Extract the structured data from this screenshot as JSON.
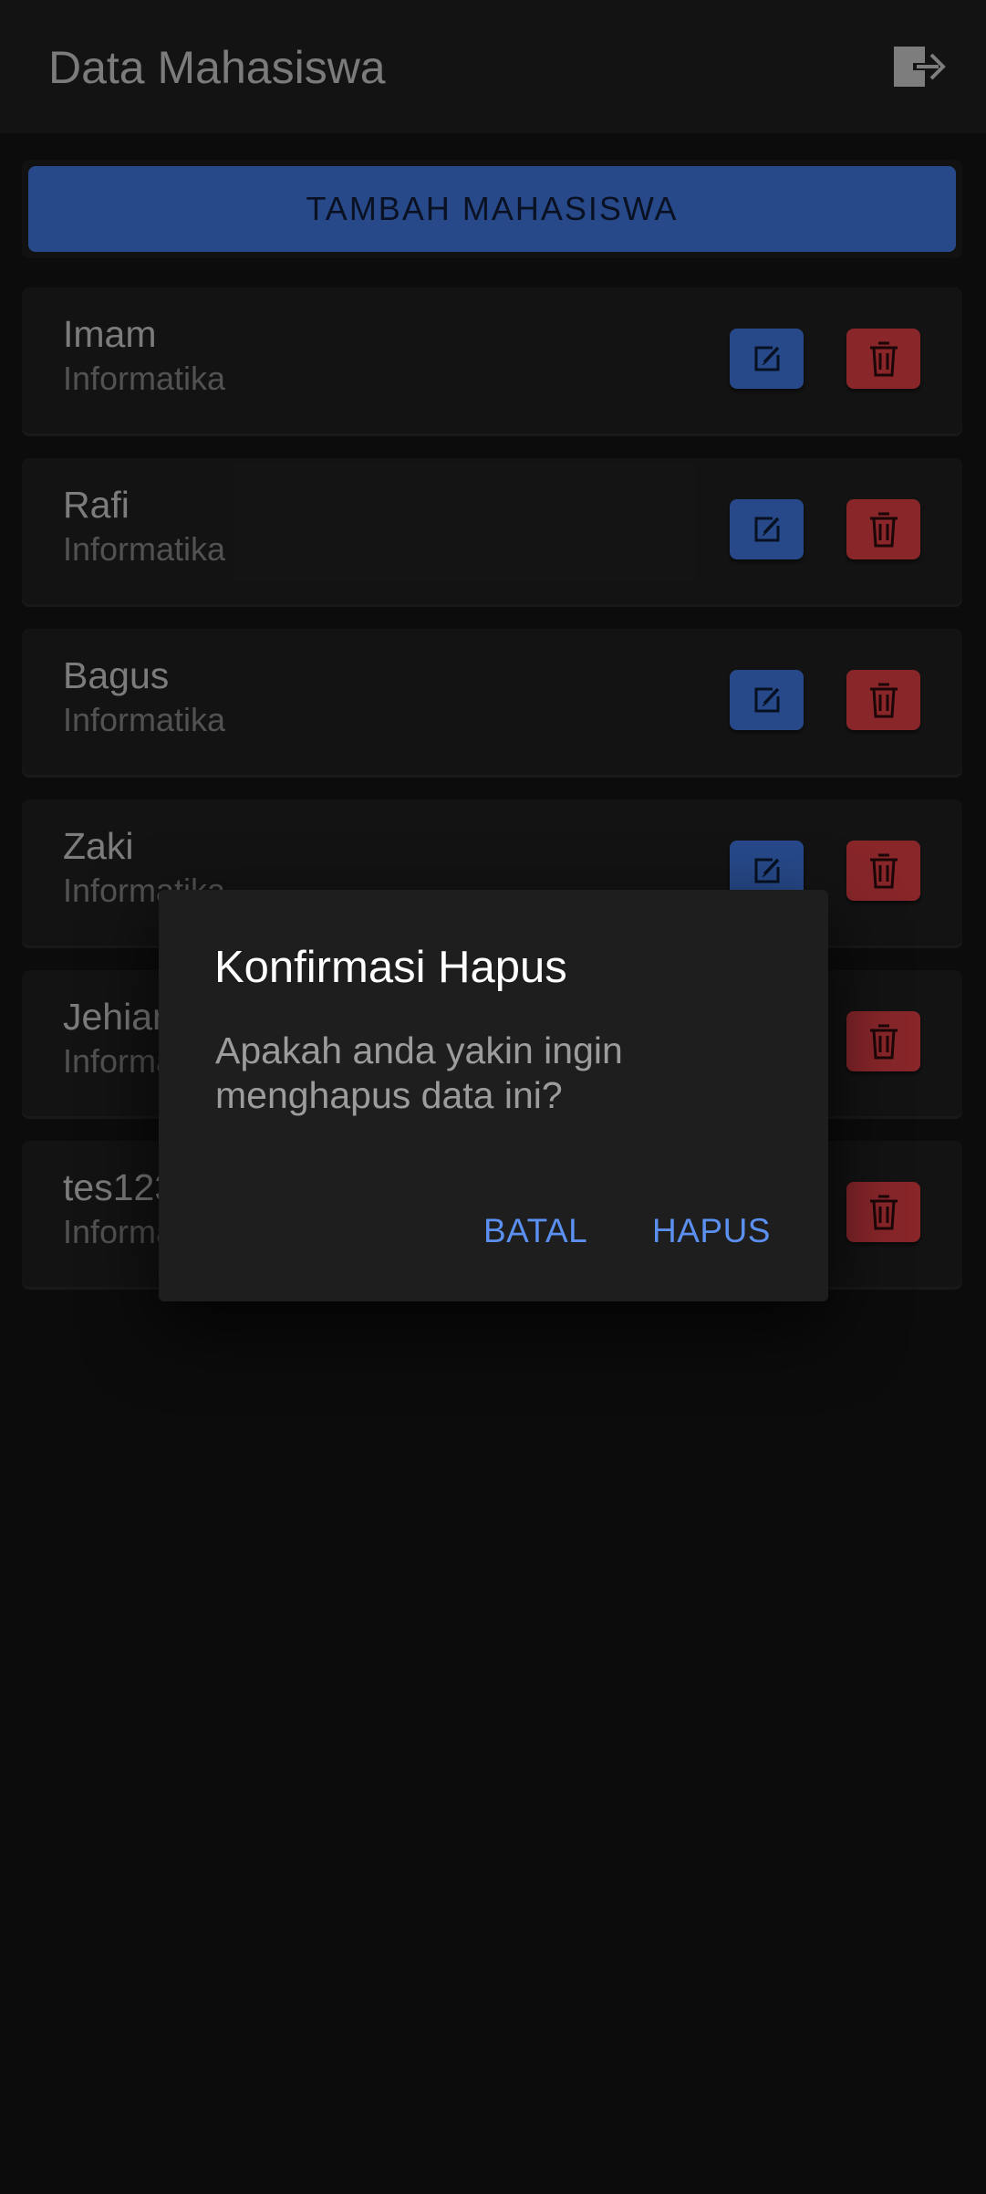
{
  "appbar": {
    "title": "Data Mahasiswa",
    "logout_icon": "logout-icon"
  },
  "add_button": {
    "label": "TAMBAH MAHASISWA"
  },
  "students": [
    {
      "name": "Imam",
      "major": "Informatika"
    },
    {
      "name": "Rafi",
      "major": "Informatika"
    },
    {
      "name": "Bagus",
      "major": "Informatika"
    },
    {
      "name": "Zaki",
      "major": "Informatika"
    },
    {
      "name": "Jehian",
      "major": "Informatika"
    },
    {
      "name": "tes123",
      "major": "Informatika"
    }
  ],
  "dialog": {
    "title": "Konfirmasi Hapus",
    "message": "Apakah anda yakin ingin menghapus data ini?",
    "cancel_label": "BATAL",
    "confirm_label": "HAPUS"
  },
  "colors": {
    "primary": "#3a6ccc",
    "danger": "#c9383f",
    "dialog_action": "#5b8ff0"
  }
}
